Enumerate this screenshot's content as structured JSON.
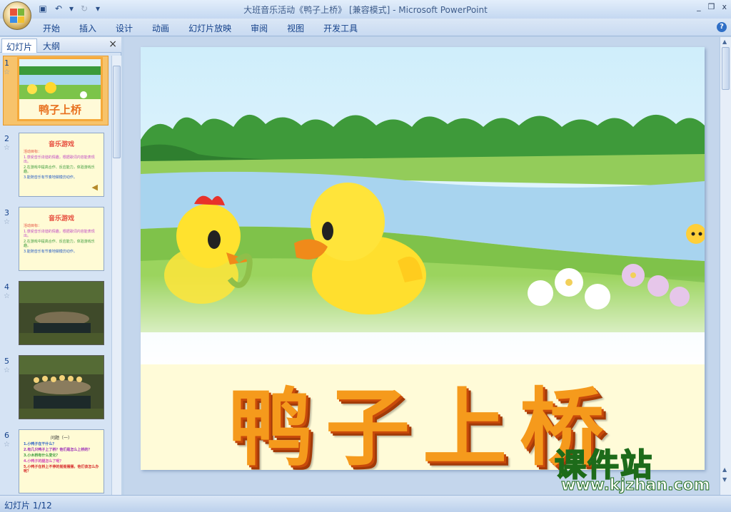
{
  "window": {
    "title": "大班音乐活动《鸭子上桥》 [兼容模式] - Microsoft PowerPoint",
    "controls": [
      "_",
      "❐",
      "x"
    ]
  },
  "qat": {
    "save_icon": "save-icon",
    "undo_icon": "undo-icon",
    "redo_icon": "redo-icon",
    "customize_icon": "customize-icon"
  },
  "ribbon": {
    "tabs": [
      "开始",
      "插入",
      "设计",
      "动画",
      "幻灯片放映",
      "审阅",
      "视图",
      "开发工具"
    ],
    "help": "?"
  },
  "pane": {
    "tab_slides": "幻灯片",
    "tab_outline": "大纲",
    "close": "×"
  },
  "thumbnails": [
    {
      "num": "1",
      "title": "鸭子上桥"
    },
    {
      "num": "2",
      "title": "音乐游戏",
      "lines": [
        "活动目标：",
        "1.感受音乐诙谐的情趣，根据歌词内容能表现出。",
        "2.在游戏中提高合作、反应能力，体验游戏乐趣。",
        "3.能随音乐有节奏地做模仿动作。"
      ]
    },
    {
      "num": "3",
      "title": "音乐游戏",
      "lines": [
        "活动目标：",
        "1.感受音乐诙谐的情趣，根据歌词内容能表现出。",
        "2.在游戏中提高合作、反应能力，体验游戏乐趣。",
        "3.能随音乐有节奏地做模仿动作。"
      ]
    },
    {
      "num": "4",
      "title": ""
    },
    {
      "num": "5",
      "title": ""
    },
    {
      "num": "6",
      "title": "问题（一）",
      "lines": [
        "1.小鸭子在干什么？",
        "2.有几只鸭子上了桥？他们是怎么上桥的？",
        "3.小木桥有什么变化？",
        "4.小鸭子的腿怎么了呢？",
        "5.小鸭子在桥上不停的摇摇摆摆，他们该怎么办呢？"
      ]
    }
  ],
  "slide": {
    "title": "鸭子上桥"
  },
  "status": {
    "text": "幻灯片 1/12"
  },
  "watermark": {
    "big": "课件站",
    "small": "www.kjzhan.com"
  }
}
